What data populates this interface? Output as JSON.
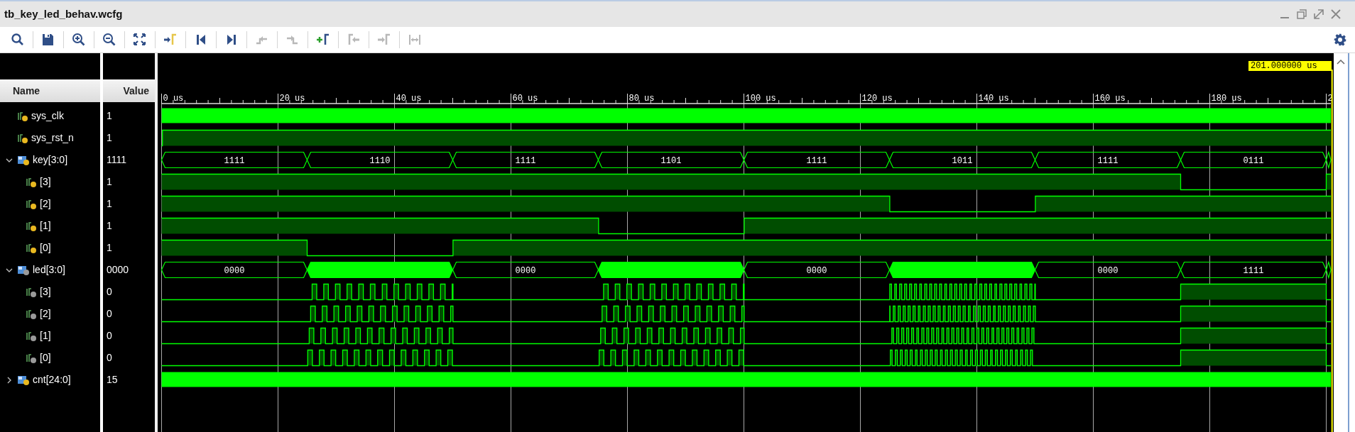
{
  "window": {
    "title": "tb_key_led_behav.wcfg"
  },
  "toolbar": [
    {
      "kind": "search",
      "disabled": false
    },
    {
      "kind": "save",
      "disabled": false
    },
    {
      "kind": "zoom-in",
      "disabled": false
    },
    {
      "kind": "zoom-out",
      "disabled": false
    },
    {
      "kind": "zoom-fit",
      "disabled": false
    },
    {
      "kind": "go-to-cursor",
      "disabled": false
    },
    {
      "kind": "go-to-start",
      "disabled": false
    },
    {
      "kind": "go-to-end",
      "disabled": false
    },
    {
      "kind": "previous-transition",
      "disabled": true
    },
    {
      "kind": "next-transition",
      "disabled": true
    },
    {
      "kind": "add-marker",
      "disabled": false
    },
    {
      "kind": "previous-marker",
      "disabled": true
    },
    {
      "kind": "next-marker",
      "disabled": true
    },
    {
      "kind": "swap-cursors",
      "disabled": true
    }
  ],
  "columns": {
    "name": "Name",
    "value": "Value"
  },
  "ruler": [
    "0 us",
    "20 us",
    "40 us",
    "60 us",
    "80 us",
    "100 us",
    "120 us",
    "140 us",
    "160 us",
    "180 us",
    "2"
  ],
  "cursor": {
    "time": "201.000000 us"
  },
  "signals": [
    {
      "name": "sys_clk",
      "value": "1",
      "kind": "clock",
      "color": "#e8b820"
    },
    {
      "name": "sys_rst_n",
      "value": "1",
      "kind": "bit",
      "color": "#e8b820"
    },
    {
      "name": "key[3:0]",
      "value": "1111",
      "kind": "bus",
      "color": "#e8b820",
      "expanded": true,
      "segments": [
        {
          "kind": "value",
          "text": "1111"
        },
        {
          "kind": "value",
          "text": "1110"
        },
        {
          "kind": "value",
          "text": "1111"
        },
        {
          "kind": "value",
          "text": "1101"
        },
        {
          "kind": "value",
          "text": "1111"
        },
        {
          "kind": "value",
          "text": "1011"
        },
        {
          "kind": "value",
          "text": "1111"
        },
        {
          "kind": "value",
          "text": "0111"
        }
      ],
      "children": [
        {
          "name": "[3]",
          "value": "1",
          "kind": "bit",
          "color": "#e8b820"
        },
        {
          "name": "[2]",
          "value": "1",
          "kind": "bit",
          "color": "#e8b820"
        },
        {
          "name": "[1]",
          "value": "1",
          "kind": "bit",
          "color": "#e8b820"
        },
        {
          "name": "[0]",
          "value": "1",
          "kind": "bit",
          "color": "#e8b820"
        }
      ]
    },
    {
      "name": "led[3:0]",
      "value": "0000",
      "kind": "bus",
      "color": "#9a9a9a",
      "expanded": true,
      "segments": [
        {
          "kind": "value",
          "text": "0000"
        },
        {
          "kind": "blink_slow"
        },
        {
          "kind": "value",
          "text": "0000"
        },
        {
          "kind": "blink_slow"
        },
        {
          "kind": "value",
          "text": "0000"
        },
        {
          "kind": "blink_fast"
        },
        {
          "kind": "value",
          "text": "0000"
        },
        {
          "kind": "value",
          "text": "1111"
        }
      ],
      "children": [
        {
          "name": "[3]",
          "value": "0",
          "kind": "bit",
          "color": "#9a9a9a"
        },
        {
          "name": "[2]",
          "value": "0",
          "kind": "bit",
          "color": "#9a9a9a"
        },
        {
          "name": "[1]",
          "value": "0",
          "kind": "bit",
          "color": "#9a9a9a"
        },
        {
          "name": "[0]",
          "value": "0",
          "kind": "bit",
          "color": "#9a9a9a"
        }
      ]
    },
    {
      "name": "cnt[24:0]",
      "value": "15",
      "kind": "counter",
      "color": "#e8b820",
      "expanded": false
    }
  ]
}
